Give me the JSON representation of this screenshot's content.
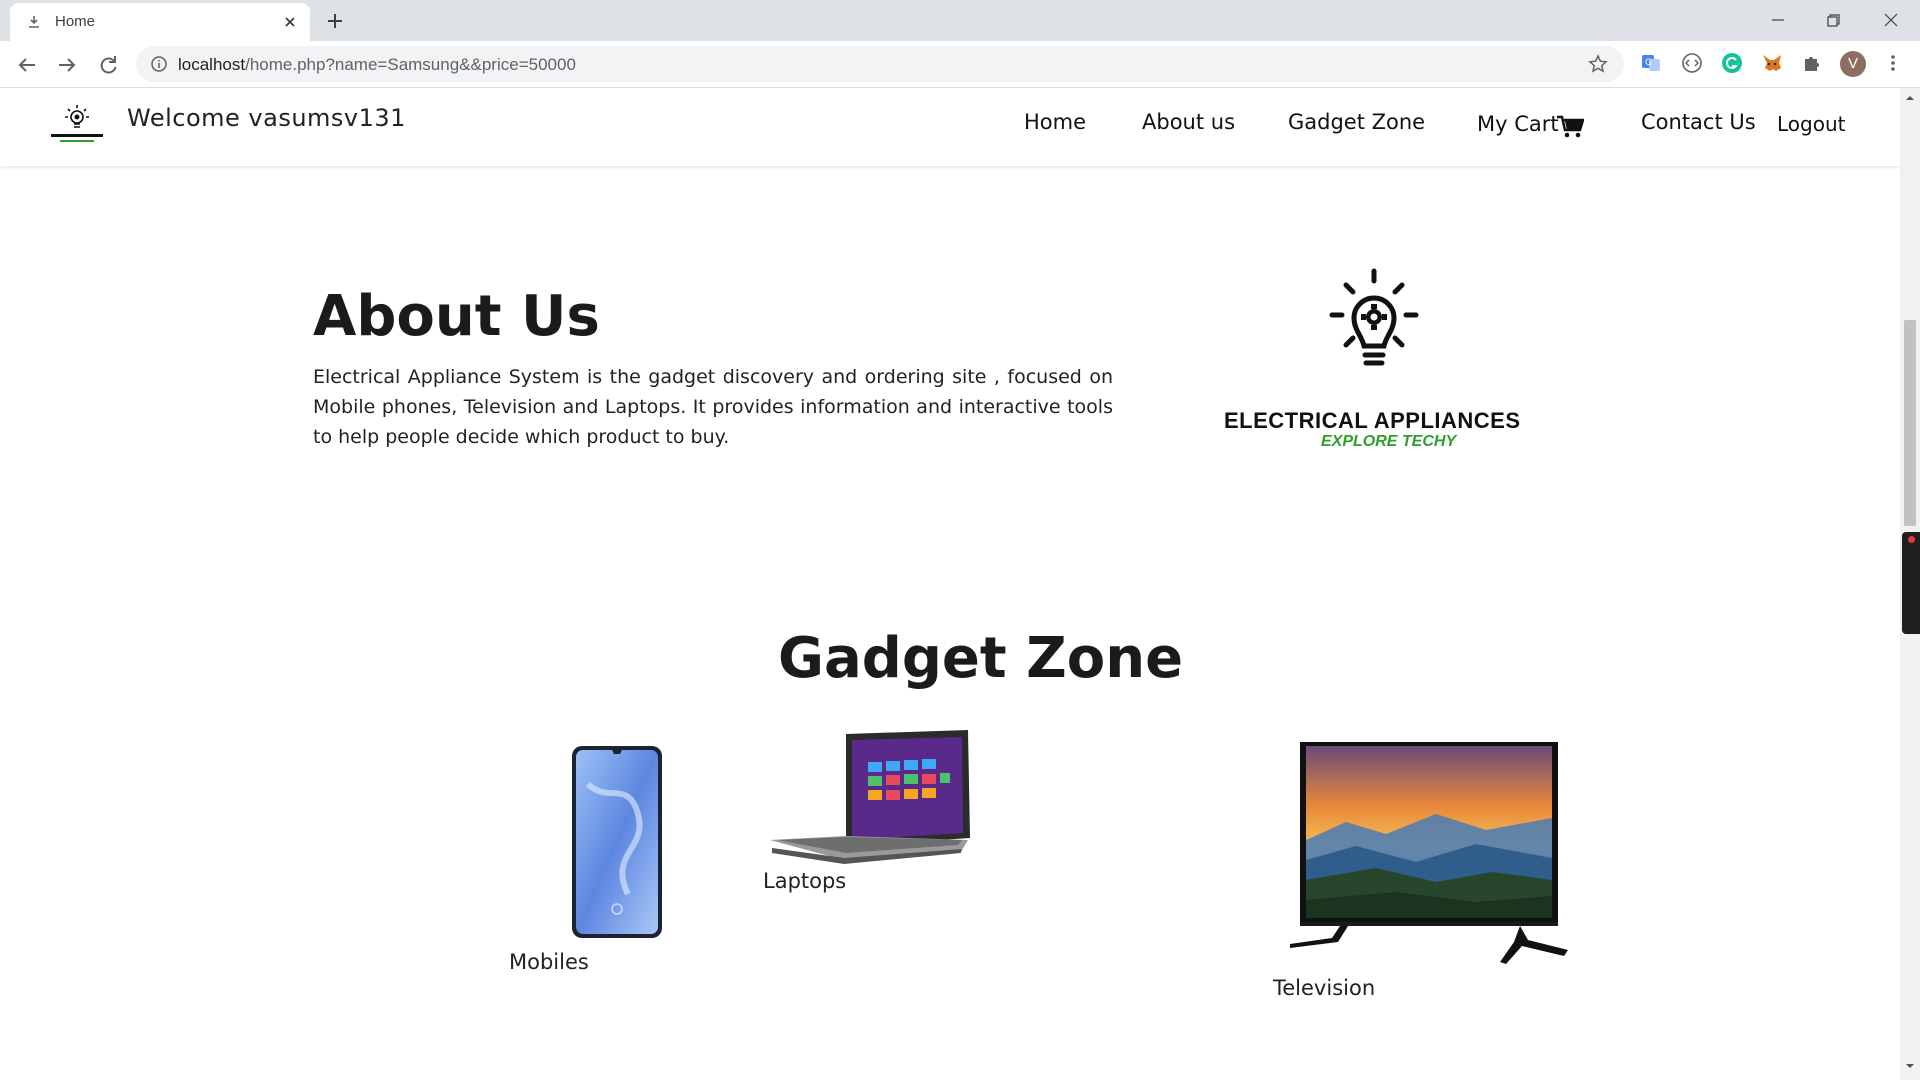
{
  "browser": {
    "tab_title": "Home",
    "url_host": "localhost",
    "url_path": "/home.php?name=Samsung&&price=50000",
    "profile_initial": "V"
  },
  "header": {
    "welcome": "Welcome vasumsv131",
    "nav": {
      "home": "Home",
      "about": "About us",
      "gadget_zone": "Gadget Zone",
      "cart": "My Cart",
      "contact": "Contact Us",
      "logout": "Logout"
    }
  },
  "about": {
    "title": "About Us",
    "text": "Electrical Appliance System is the gadget discovery and ordering site , focused on Mobile phones, Television and Laptops. It provides information and interactive tools to help people decide which product to buy.",
    "brand_name": "ELECTRICAL APPLIANCES",
    "brand_tagline": "EXPLORE TECHY"
  },
  "gadget_zone": {
    "title": "Gadget Zone",
    "products": [
      {
        "label": "Mobiles"
      },
      {
        "label": "Laptops"
      },
      {
        "label": "Television"
      }
    ]
  },
  "overlay": {
    "recorder": "screenrec"
  },
  "colors": {
    "accent_green": "#2e9e2e",
    "tabstrip_bg": "#dee1e6",
    "omnibox_bg": "#f1f3f4"
  }
}
